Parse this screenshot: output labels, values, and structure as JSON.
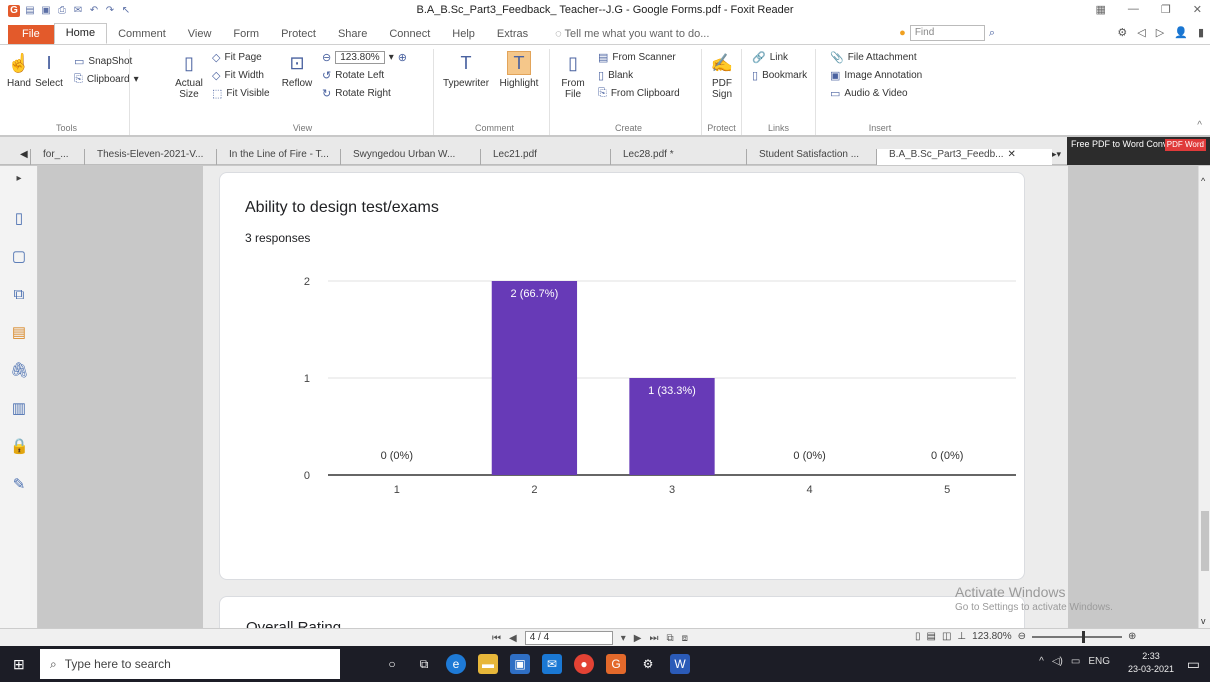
{
  "window": {
    "title": "B.A_B.Sc_Part3_Feedback_ Teacher--J.G - Google Forms.pdf - Foxit Reader"
  },
  "menu": {
    "file": "File",
    "tabs": [
      "Home",
      "Comment",
      "View",
      "Form",
      "Protect",
      "Share",
      "Connect",
      "Help",
      "Extras"
    ],
    "tell_me": "Tell me what you want to do...",
    "find_placeholder": "Find"
  },
  "ribbon": {
    "tools": {
      "hand": "Hand",
      "select": "Select",
      "snapshot": "SnapShot",
      "clipboard": "Clipboard",
      "label": "Tools"
    },
    "view": {
      "actual_size": "Actual Size",
      "fit_page": "Fit Page",
      "fit_width": "Fit Width",
      "fit_visible": "Fit Visible",
      "reflow": "Reflow",
      "zoom": "123.80%",
      "rotate_left": "Rotate Left",
      "rotate_right": "Rotate Right",
      "label": "View"
    },
    "comment": {
      "typewriter": "Typewriter",
      "highlight": "Highlight",
      "label": "Comment"
    },
    "create": {
      "from_file": "From File",
      "from_scanner": "From Scanner",
      "blank": "Blank",
      "from_clipboard": "From Clipboard",
      "label": "Create"
    },
    "protect": {
      "pdf_sign": "PDF Sign",
      "label": "Protect"
    },
    "links": {
      "link": "Link",
      "bookmark": "Bookmark",
      "label": "Links"
    },
    "insert": {
      "file_attachment": "File Attachment",
      "image_annotation": "Image Annotation",
      "audio_video": "Audio & Video",
      "label": "Insert"
    }
  },
  "doc_tabs": [
    "for_...",
    "Thesis-Eleven-2021-V...",
    "In the Line of Fire - T...",
    "Swyngedou Urban W...",
    "Lec21.pdf",
    "Lec28.pdf *",
    "Student Satisfaction ...",
    "B.A_B.Sc_Part3_Feedb..."
  ],
  "ad": {
    "text": "Free PDF to Word Converter",
    "badge": "PDF Word"
  },
  "page": {
    "question_title": "Ability to design test/exams",
    "responses": "3 responses",
    "next_title": "Overall Rating"
  },
  "chart_data": {
    "type": "bar",
    "categories": [
      "1",
      "2",
      "3",
      "4",
      "5"
    ],
    "values": [
      0,
      2,
      1,
      0,
      0
    ],
    "data_labels": [
      "0 (0%)",
      "2 (66.7%)",
      "1 (33.3%)",
      "0 (0%)",
      "0 (0%)"
    ],
    "y_ticks": [
      "0",
      "1",
      "2"
    ],
    "ylim": [
      0,
      2
    ],
    "grid": true,
    "bar_color": "#673ab7",
    "title": "",
    "xlabel": "",
    "ylabel": ""
  },
  "watermark": {
    "line1": "Activate Windows",
    "line2": "Go to Settings to activate Windows."
  },
  "status": {
    "page_indicator": "4 / 4",
    "zoom": "123.80%"
  },
  "taskbar": {
    "search_placeholder": "Type here to search",
    "lang": "ENG",
    "time": "2:33",
    "date": "23-03-2021"
  }
}
